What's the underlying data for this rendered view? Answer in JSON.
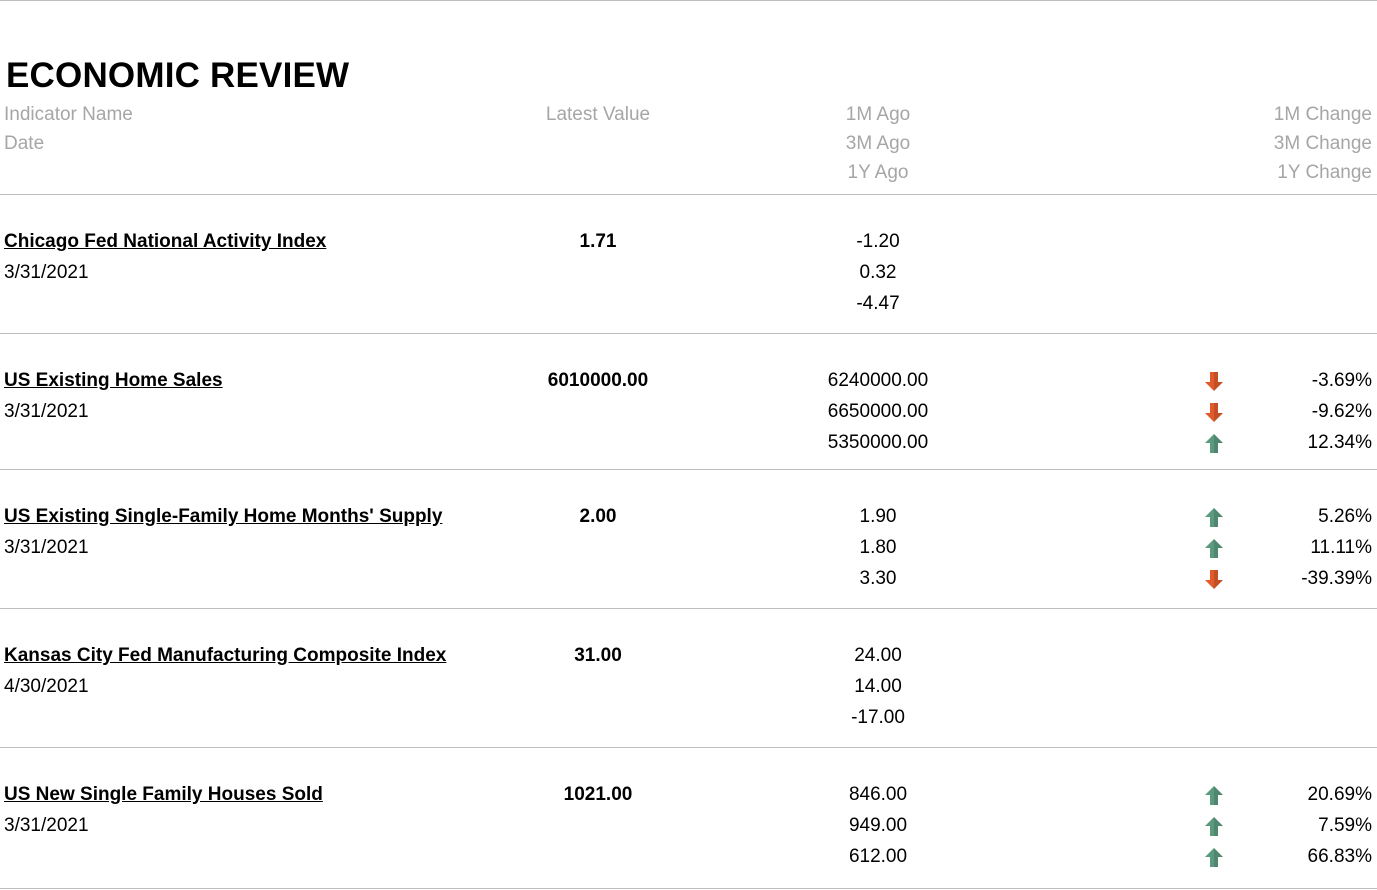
{
  "title": "ECONOMIC REVIEW",
  "header": {
    "indicator_name": "Indicator Name",
    "date": "Date",
    "latest_value": "Latest Value",
    "ago": [
      "1M Ago",
      "3M Ago",
      "1Y Ago"
    ],
    "change": [
      "1M Change",
      "3M Change",
      "1Y Change"
    ]
  },
  "colors": {
    "up": "#5b9a7f",
    "down": "#e05a2b",
    "header_text": "#a6a6a6",
    "rule": "#bfbfbf"
  },
  "indicators": [
    {
      "name": "Chicago Fed National Activity Index",
      "date": "3/31/2021",
      "latest": "1.71",
      "ago": [
        "-1.20",
        "0.32",
        "-4.47"
      ],
      "changes": []
    },
    {
      "name": "US Existing Home Sales",
      "date": "3/31/2021",
      "latest": "6010000.00",
      "ago": [
        "6240000.00",
        "6650000.00",
        "5350000.00"
      ],
      "changes": [
        {
          "value": "-3.69%",
          "direction": "down"
        },
        {
          "value": "-9.62%",
          "direction": "down"
        },
        {
          "value": "12.34%",
          "direction": "up"
        }
      ]
    },
    {
      "name": "US Existing Single-Family Home Months' Supply",
      "date": "3/31/2021",
      "latest": "2.00",
      "ago": [
        "1.90",
        "1.80",
        "3.30"
      ],
      "changes": [
        {
          "value": "5.26%",
          "direction": "up"
        },
        {
          "value": "11.11%",
          "direction": "up"
        },
        {
          "value": "-39.39%",
          "direction": "down"
        }
      ]
    },
    {
      "name": "Kansas City Fed Manufacturing Composite Index",
      "date": "4/30/2021",
      "latest": "31.00",
      "ago": [
        "24.00",
        "14.00",
        "-17.00"
      ],
      "changes": []
    },
    {
      "name": "US New Single Family Houses Sold",
      "date": "3/31/2021",
      "latest": "1021.00",
      "ago": [
        "846.00",
        "949.00",
        "612.00"
      ],
      "changes": [
        {
          "value": "20.69%",
          "direction": "up"
        },
        {
          "value": "7.59%",
          "direction": "up"
        },
        {
          "value": "66.83%",
          "direction": "up"
        }
      ]
    }
  ]
}
